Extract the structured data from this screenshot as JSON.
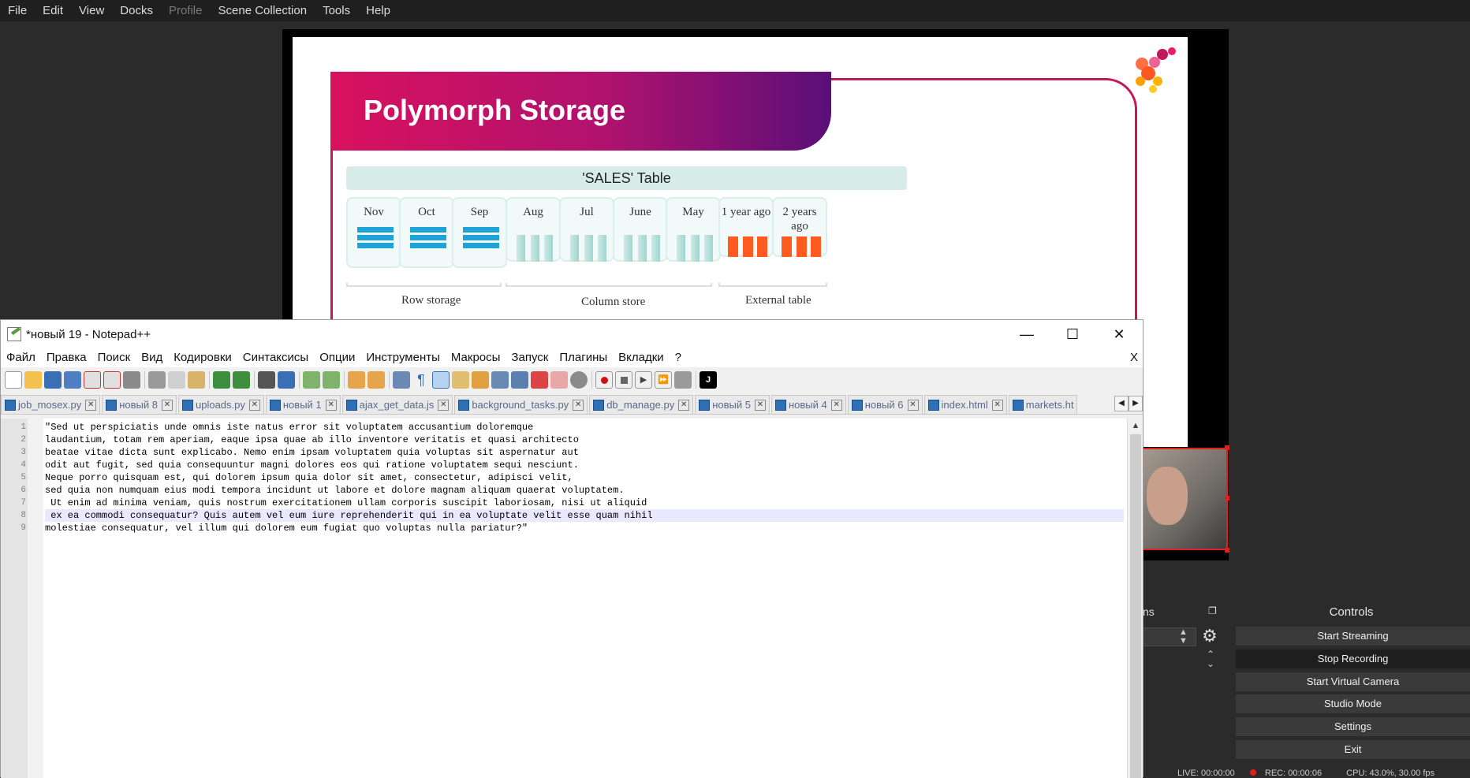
{
  "obs": {
    "menu": [
      "File",
      "Edit",
      "View",
      "Docks",
      "Profile",
      "Scene Collection",
      "Tools",
      "Help"
    ],
    "slide": {
      "title": "Polymorph Storage",
      "table_title": "'SALES' Table",
      "months": [
        "Nov",
        "Oct",
        "Sep",
        "Aug",
        "Jul",
        "June",
        "May",
        "1 year ago",
        "2 years ago"
      ],
      "groups": [
        "Row storage",
        "Column store",
        "External table"
      ]
    },
    "sources_title": "ns",
    "controls": {
      "header": "Controls",
      "buttons": [
        "Start Streaming",
        "Stop Recording",
        "Start Virtual Camera",
        "Studio Mode",
        "Settings",
        "Exit"
      ]
    },
    "status": {
      "live": "LIVE: 00:00:00",
      "rec": "REC: 00:00:06",
      "cpu": "CPU: 43.0%, 30.00 fps"
    },
    "colors": {
      "accent": "#d8115f",
      "recording": "#e02020"
    }
  },
  "notepad": {
    "title": "*новый 19 - Notepad++",
    "menu": [
      "Файл",
      "Правка",
      "Поиск",
      "Вид",
      "Кодировки",
      "Синтаксисы",
      "Опции",
      "Инструменты",
      "Макросы",
      "Запуск",
      "Плагины",
      "Вкладки",
      "?"
    ],
    "close_doc": "X",
    "tabs": [
      "job_mosex.py",
      "новый 8",
      "uploads.py",
      "новый 1",
      "ajax_get_data.js",
      "background_tasks.py",
      "db_manage.py",
      "новый 5",
      "новый 4",
      "новый 6",
      "index.html",
      "markets.ht"
    ],
    "lines": [
      "\"Sed ut perspiciatis unde omnis iste natus error sit voluptatem accusantium doloremque",
      "laudantium, totam rem aperiam, eaque ipsa quae ab illo inventore veritatis et quasi architecto",
      "beatae vitae dicta sunt explicabo. Nemo enim ipsam voluptatem quia voluptas sit aspernatur aut",
      "odit aut fugit, sed quia consequuntur magni dolores eos qui ratione voluptatem sequi nesciunt.",
      "Neque porro quisquam est, qui dolorem ipsum quia dolor sit amet, consectetur, adipisci velit,",
      "sed quia non numquam eius modi tempora incidunt ut labore et dolore magnam aliquam quaerat voluptatem.",
      " Ut enim ad minima veniam, quis nostrum exercitationem ullam corporis suscipit laboriosam, nisi ut aliquid",
      " ex ea commodi consequatur? Quis autem vel eum iure reprehenderit qui in ea voluptate velit esse quam nihil",
      "molestiae consequatur, vel illum qui dolorem eum fugiat quo voluptas nulla pariatur?\""
    ],
    "line_numbers": [
      "1",
      "2",
      "3",
      "4",
      "5",
      "6",
      "7",
      "8",
      "9"
    ]
  }
}
